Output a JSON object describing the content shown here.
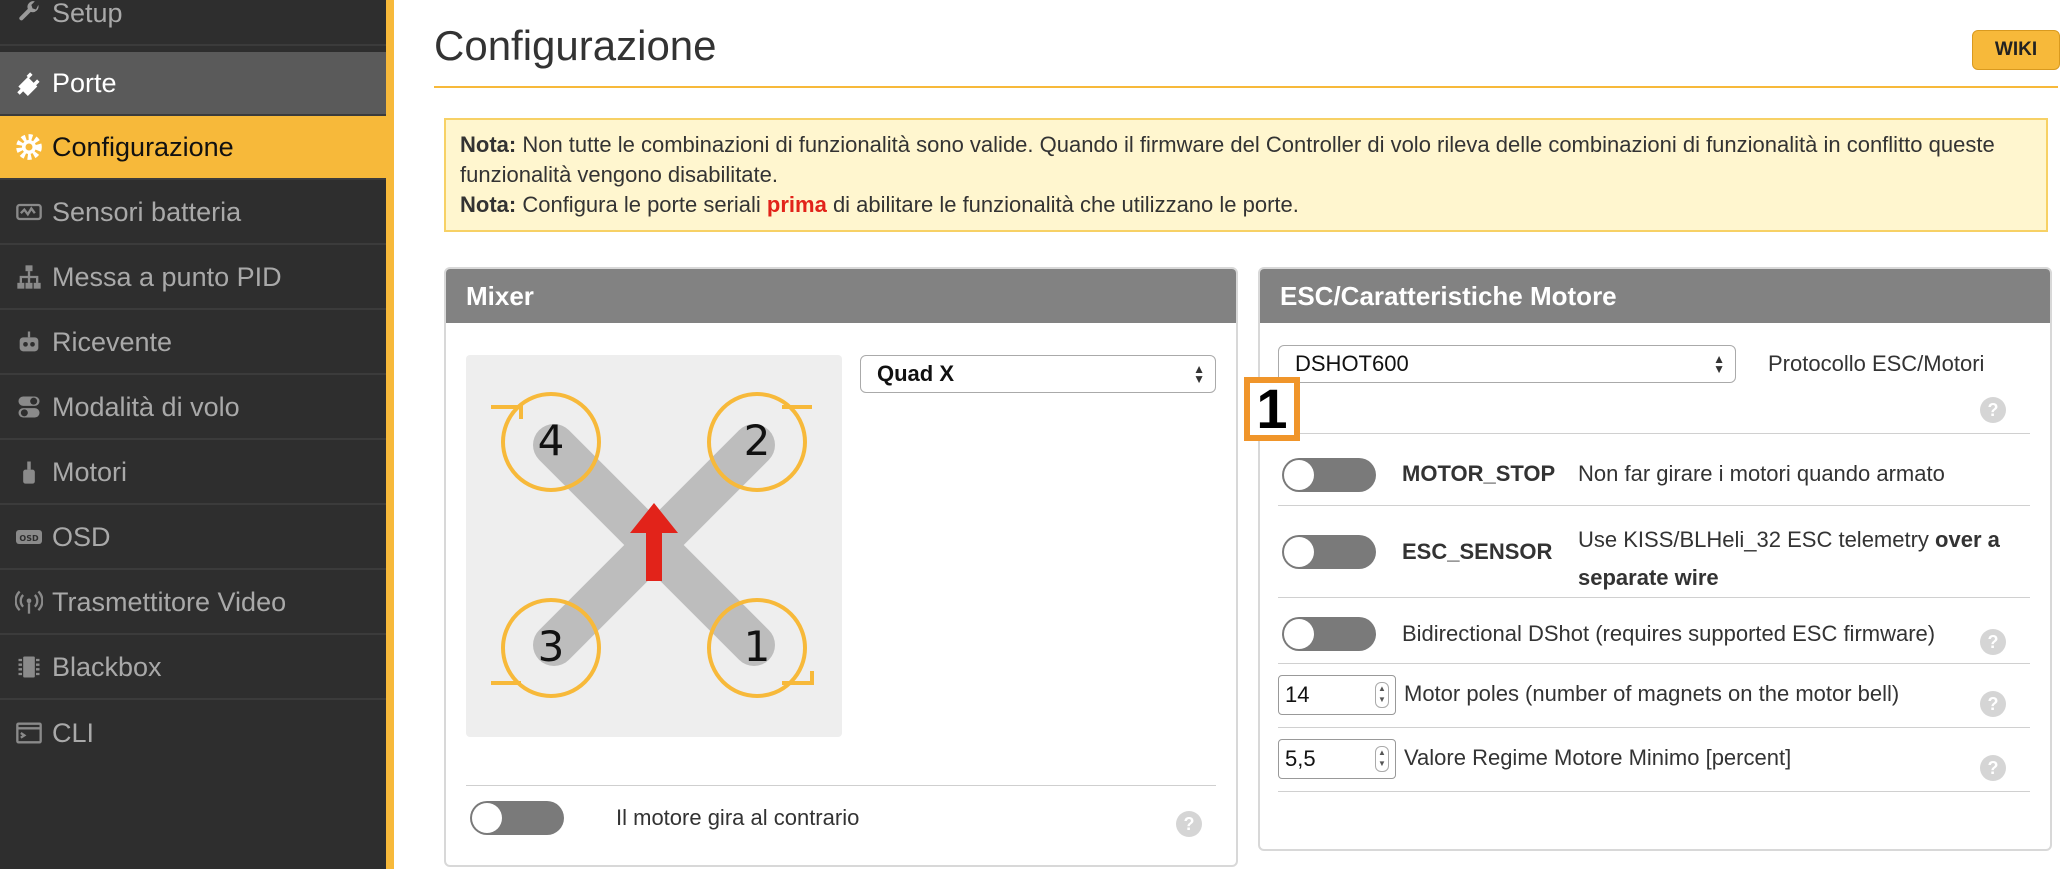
{
  "sidebar": {
    "items": [
      {
        "label": "Setup",
        "icon": "wrench-icon"
      },
      {
        "label": "Porte",
        "icon": "plug-icon"
      },
      {
        "label": "Configurazione",
        "icon": "gear-icon"
      },
      {
        "label": "Sensori batteria",
        "icon": "battery-sensor-icon"
      },
      {
        "label": "Messa a punto PID",
        "icon": "pid-tree-icon"
      },
      {
        "label": "Ricevente",
        "icon": "receiver-robot-icon"
      },
      {
        "label": "Modalità di volo",
        "icon": "switch-icon"
      },
      {
        "label": "Motori",
        "icon": "motor-icon"
      },
      {
        "label": "OSD",
        "icon": "osd-icon"
      },
      {
        "label": "Trasmettitore Video",
        "icon": "broadcast-icon"
      },
      {
        "label": "Blackbox",
        "icon": "blackbox-icon"
      },
      {
        "label": "CLI",
        "icon": "terminal-icon"
      }
    ]
  },
  "header": {
    "title": "Configurazione",
    "wiki_label": "WIKI"
  },
  "notice": {
    "line1_bold": "Nota:",
    "line1_text": " Non tutte le combinazioni di funzionalità sono valide. Quando il firmware del Controller di volo rileva delle combinazioni di funzionalità in conflitto queste funzionalità vengono disabilitate.",
    "line2_bold": "Nota:",
    "line2_pre": " Configura le porte seriali ",
    "line2_red": "prima",
    "line2_post": " di abilitare le funzionalità che utilizzano le porte."
  },
  "mixer": {
    "title": "Mixer",
    "selected": "Quad X",
    "motor_labels": [
      "4",
      "2",
      "3",
      "1"
    ],
    "reverse_label": "Il motore gira al contrario"
  },
  "esc": {
    "title": "ESC/Caratteristiche Motore",
    "protocol_value": "DSHOT600",
    "protocol_label": "Protocollo ESC/Motori",
    "motor_stop_name": "MOTOR_STOP",
    "motor_stop_desc": "Non far girare i motori quando armato",
    "esc_sensor_name": "ESC_SENSOR",
    "esc_sensor_desc_pre": "Use KISS/BLHeli_32 ESC telemetry ",
    "esc_sensor_desc_bold1": "over a",
    "esc_sensor_desc_bold2": "separate wire",
    "bidir_label": "Bidirectional DShot (requires supported ESC firmware)",
    "poles_value": "14",
    "poles_label": "Motor poles (number of magnets on the motor bell)",
    "idle_value": "5,5",
    "idle_label": "Valore Regime Motore Minimo [percent]"
  },
  "marker": "1",
  "help_glyph": "?",
  "colors": {
    "accent": "#f7b93a",
    "sidebar_bg": "#2e2e2e",
    "panel_header": "#828282",
    "arrow": "#e2231a"
  }
}
